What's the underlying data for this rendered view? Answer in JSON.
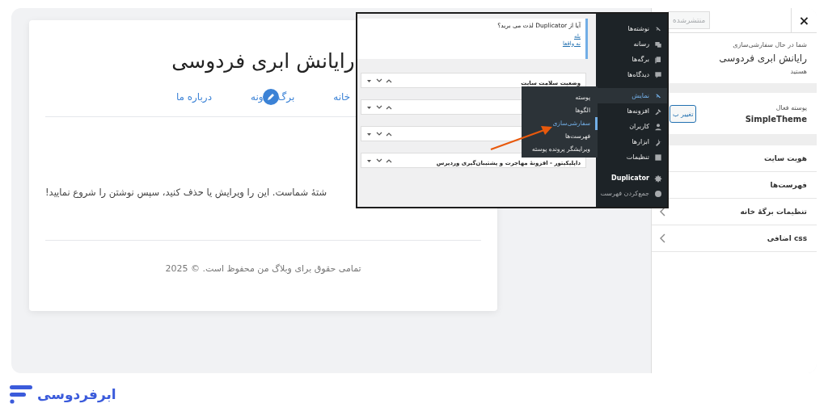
{
  "preview": {
    "site_title": "رایانش ابری فردوسی",
    "nav": [
      {
        "parts": [
          "خانه"
        ]
      },
      {
        "parts": [
          "برگ",
          "ونه"
        ]
      },
      {
        "parts": [
          "درباره ما"
        ]
      }
    ],
    "post_excerpt": "شتهٔ شماست. این را ویرایش یا حذف کنید، سپس نوشتن را شروع نمایید!",
    "footer": "تمامی حقوق برای وبلاگ من محفوظ است. © 2025"
  },
  "customizer": {
    "close": "×",
    "publish_button": {
      "label": "منتشرشده",
      "disabled": true
    },
    "intro": "شما در حال سفارشی‌سازی",
    "site_name": "رایانش ابری فردوسی",
    "intro_end": "هستید",
    "theme_label": "پوسته فعال",
    "theme_name": "SimpleTheme",
    "change_button": "تغییر ب",
    "sections": [
      {
        "label": "هویت سایت"
      },
      {
        "label": "فهرست‌ها"
      },
      {
        "label": "تنظیمات برگهٔ خانه",
        "chevron": true
      },
      {
        "label": "css اضافی",
        "chevron": true
      }
    ]
  },
  "inset": {
    "notice": {
      "question": "آیا از Duplicator لذت می برید؟",
      "links": [
        "بله",
        "نه واقعا"
      ]
    },
    "widgets": [
      {
        "kind": "titled",
        "title": "وضعیت سلامت سایت"
      },
      {
        "kind": "covered"
      },
      {
        "kind": "covered"
      },
      {
        "kind": "titled",
        "title": "داپلیکیتور - افزونهٔ مهاجرت و پشتیبان‌گیری وردپرس"
      }
    ],
    "menu_groups": [
      [
        {
          "label": "نوشته‌ها",
          "kind": "plain",
          "selected": false
        },
        {
          "label": "رسانه",
          "kind": "plain",
          "selected": false
        },
        {
          "label": "برگه‌ها",
          "kind": "plain",
          "selected": false
        },
        {
          "label": "دیدگاه‌ها",
          "kind": "plain",
          "selected": false
        }
      ],
      [
        {
          "label": "نمایش",
          "kind": "plain",
          "selected": true
        },
        {
          "label": "افزونه‌ها",
          "kind": "plain",
          "selected": false
        },
        {
          "label": "کاربران",
          "kind": "plain",
          "selected": false
        },
        {
          "label": "ابزارها",
          "kind": "plain",
          "selected": false
        },
        {
          "label": "تنظیمات",
          "kind": "plain",
          "selected": false
        }
      ],
      [
        {
          "label": "Duplicator",
          "kind": "plugin",
          "selected": false
        },
        {
          "label": "جمع‌کردن فهرست",
          "kind": "collapse",
          "selected": false
        }
      ]
    ],
    "submenu": [
      {
        "label": "پوسته",
        "selected": false
      },
      {
        "label": "الگوها",
        "selected": false
      },
      {
        "label": "سفارشی‌سازی",
        "selected": true
      },
      {
        "label": "فهرست‌ها",
        "selected": false
      },
      {
        "label": "ویرایشگر پرونده پوسته",
        "selected": false
      }
    ]
  },
  "logo": {
    "text": "ابرفردوسی"
  }
}
